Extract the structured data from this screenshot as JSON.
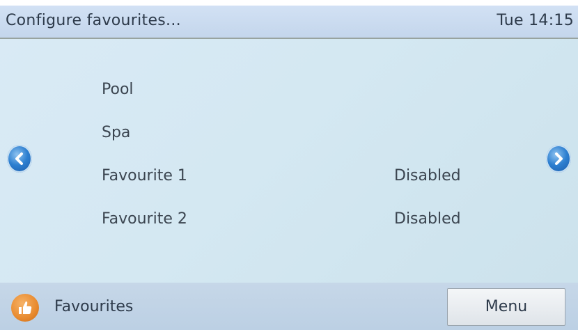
{
  "header": {
    "title": "Configure favourites...",
    "clock": "Tue 14:15"
  },
  "items": [
    {
      "label": "Pool",
      "value": ""
    },
    {
      "label": "Spa",
      "value": ""
    },
    {
      "label": "Favourite 1",
      "value": "Disabled"
    },
    {
      "label": "Favourite 2",
      "value": "Disabled"
    }
  ],
  "nav": {
    "prev_icon": "chevron-left-icon",
    "next_icon": "chevron-right-icon"
  },
  "footer": {
    "section_icon": "thumbs-up-icon",
    "section_label": "Favourites",
    "menu_label": "Menu"
  },
  "colors": {
    "accent_blue": "#2d7fd0",
    "accent_orange": "#e88a2e",
    "content_bg": "#d4e8f2"
  }
}
